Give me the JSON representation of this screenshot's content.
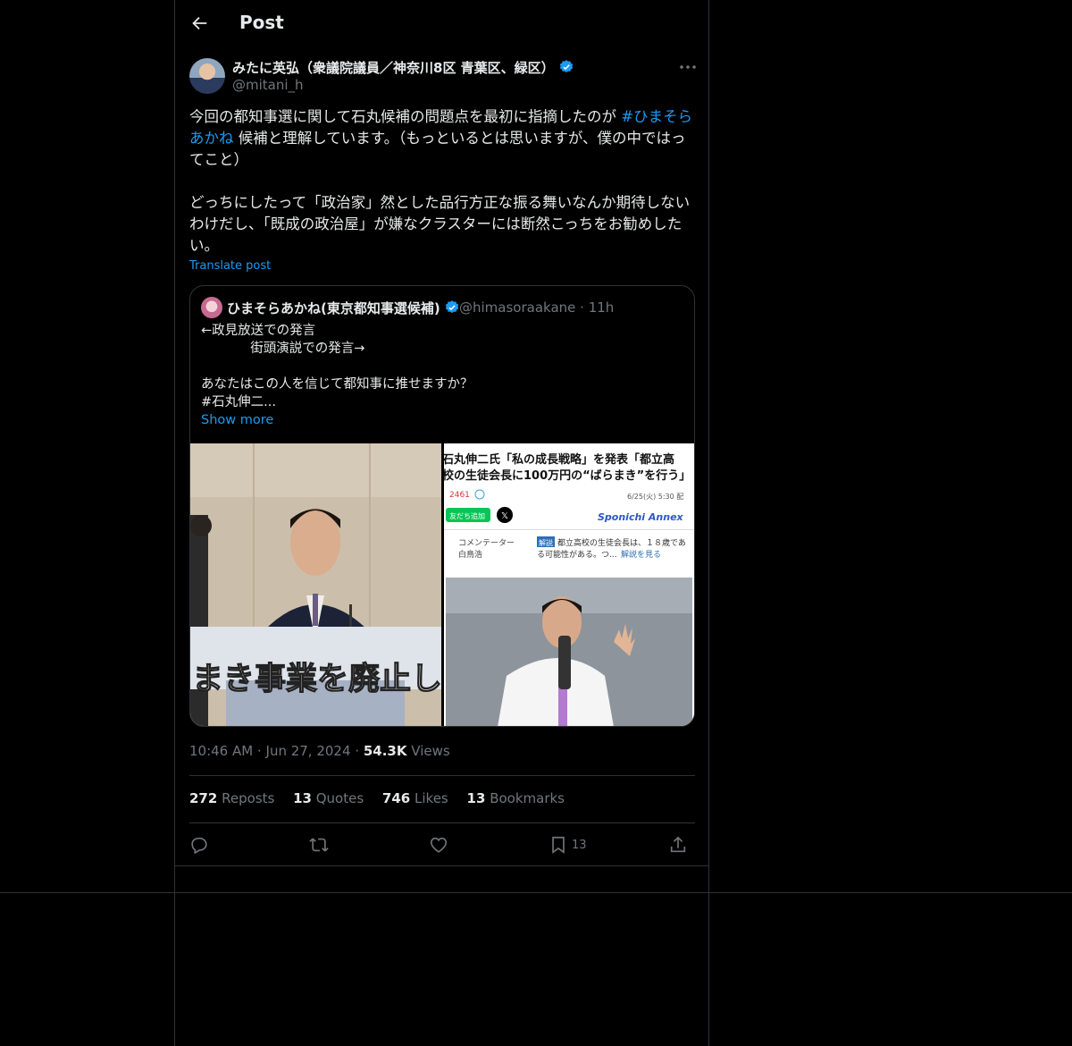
{
  "header": {
    "title": "Post"
  },
  "author": {
    "name": "みたに英弘（衆議院議員／神奈川8区 青葉区、緑区）",
    "handle": "@mitani_h"
  },
  "post": {
    "line1_a": "今回の都知事選に関して石丸候補の問題点を最初に指摘したのが ",
    "hashtag": "#ひまそらあかね",
    "line1_b": " 候補と理解しています。（もっといるとは思いますが、僕の中ではってこと）",
    "para2": "どっちにしたって「政治家」然とした品行方正な振る舞いなんか期待しないわけだし、「既成の政治屋」が嫌なクラスターには断然こっちをお勧めしたい。",
    "translate": "Translate post"
  },
  "quote": {
    "name": "ひまそらあかね(東京都知事選候補)",
    "handle": "@himasoraakane",
    "time": "11h",
    "lines": [
      "←政見放送での発言",
      "            街頭演説での発言→",
      "",
      "あなたはこの人を信じて都知事に推せますか？",
      "#石丸伸二..."
    ],
    "show_more": "Show more",
    "media": {
      "left_caption": "まき事業を廃止し",
      "right_headline_1": "石丸伸二氏「私の成長戦略」を発表「都立高",
      "right_headline_2": "校の生徒会長に100万円の“ばらまき”を行う」",
      "right_count": "2461",
      "right_date": "6/25(火) 5:30 配",
      "right_brand": "Sponichi Annex",
      "right_friend": "友だち追加",
      "right_commentator": "コメンテーター",
      "right_commentator_name": "白鳥浩",
      "right_tag": "解説",
      "right_comment": "都立高校の生徒会長は、１８歳であ",
      "right_comment2": "る可能性がある。つ...",
      "right_more": "解説を見る"
    }
  },
  "meta": {
    "time": "10:46 AM",
    "date": "Jun 27, 2024",
    "views_count": "54.3K",
    "views_label": "Views"
  },
  "stats": {
    "reposts_count": "272",
    "reposts_label": "Reposts",
    "quotes_count": "13",
    "quotes_label": "Quotes",
    "likes_count": "746",
    "likes_label": "Likes",
    "bookmarks_count": "13",
    "bookmarks_label": "Bookmarks"
  },
  "actions": {
    "bookmark_count": "13"
  },
  "colors": {
    "accent": "#1d9bf0",
    "text": "#e7e9ea",
    "muted": "#71767b",
    "border": "#2f3336",
    "bg": "#000000"
  },
  "icons": [
    "back-arrow-icon",
    "verified-badge-icon",
    "more-icon",
    "reply-icon",
    "repost-icon",
    "like-icon",
    "bookmark-icon",
    "share-icon"
  ]
}
